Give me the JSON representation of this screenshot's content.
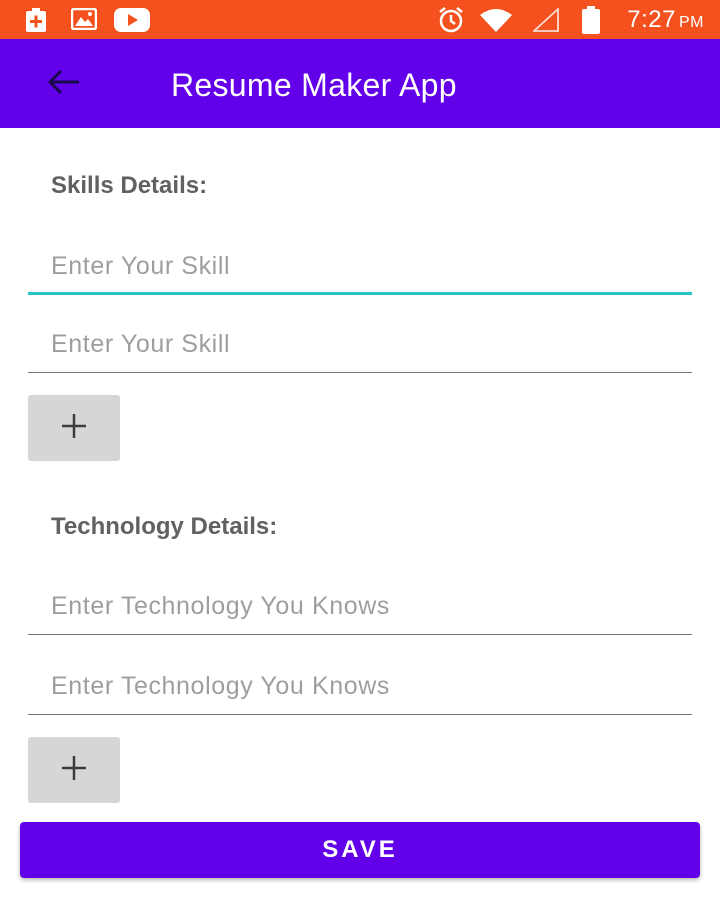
{
  "status_bar": {
    "time": "7:27",
    "ampm": "PM",
    "icons": [
      "battery-saver-icon",
      "image-icon",
      "youtube-icon",
      "alarm-icon",
      "wifi-icon",
      "signal-icon",
      "battery-icon"
    ]
  },
  "app_bar": {
    "title": "Resume Maker App",
    "back_icon": "arrow-left-icon"
  },
  "skills": {
    "label": "Skills Details:",
    "fields": [
      {
        "placeholder": "Enter Your Skill",
        "value": ""
      },
      {
        "placeholder": "Enter Your Skill",
        "value": ""
      }
    ],
    "add_label": "+"
  },
  "technology": {
    "label": "Technology Details:",
    "fields": [
      {
        "placeholder": "Enter Technology You Knows",
        "value": ""
      },
      {
        "placeholder": "Enter Technology You Knows",
        "value": ""
      }
    ],
    "add_label": "+"
  },
  "save_label": "SAVE",
  "colors": {
    "status_bar": "#f4511e",
    "app_bar": "#6200ea",
    "focus_underline": "#26c6c6",
    "add_button": "#d6d6d6",
    "label_text": "#616161",
    "placeholder": "#9e9e9e"
  }
}
